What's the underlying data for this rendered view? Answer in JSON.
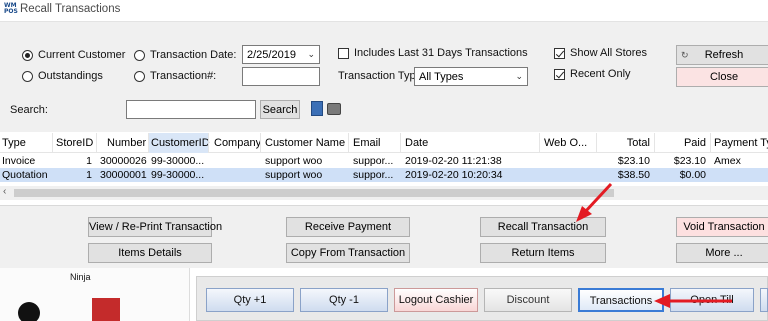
{
  "window": {
    "title": "Recall Transactions",
    "icon_text": "WM POS"
  },
  "filters": {
    "current_customer": "Current Customer",
    "outstandings": "Outstandings",
    "transaction_date": "Transaction Date:",
    "transaction_num": "Transaction#:",
    "date_value": "2/25/2019",
    "transaction_num_value": "",
    "include_31_days": "Includes Last 31 Days Transactions",
    "transaction_type_label": "Transaction Type:",
    "transaction_type_value": "All Types",
    "show_all_stores": "Show All Stores",
    "recent_only": "Recent Only",
    "refresh": "Refresh",
    "close": "Close"
  },
  "search": {
    "label": "Search:",
    "value": "",
    "button": "Search"
  },
  "grid": {
    "columns": [
      "Type",
      "StoreID",
      "Number",
      "CustomerID",
      "Company",
      "Customer Name",
      "Email",
      "Date",
      "Web O...",
      "Total",
      "Paid",
      "Payment Typ"
    ],
    "rows": [
      [
        "Invoice",
        "1",
        "30000026",
        "99-30000...",
        "",
        "support woo",
        "suppor...",
        "2019-02-20 11:21:38",
        "",
        "$23.10",
        "$23.10",
        "Amex"
      ],
      [
        "Quotation",
        "1",
        "30000001",
        "99-30000...",
        "",
        "support woo",
        "suppor...",
        "2019-02-20 10:20:34",
        "",
        "$38.50",
        "$0.00",
        ""
      ]
    ],
    "selected_row": 1
  },
  "actions": {
    "view_reprint": "View / Re-Print Transaction",
    "items_details": "Items Details",
    "receive_payment": "Receive Payment",
    "copy_from": "Copy From Transaction",
    "recall": "Recall Transaction",
    "return_items": "Return Items",
    "void": "Void Transaction",
    "more": "More ..."
  },
  "pos": {
    "ninja": "Ninja",
    "qty_plus": "Qty +1",
    "qty_minus": "Qty -1",
    "logout": "Logout Cashier",
    "discount": "Discount",
    "transactions": "Transactions",
    "open_till": "Open Till"
  },
  "colors": {
    "arrow": "#e31b23",
    "selection": "#cfe0f7",
    "focus": "#0078d7"
  }
}
